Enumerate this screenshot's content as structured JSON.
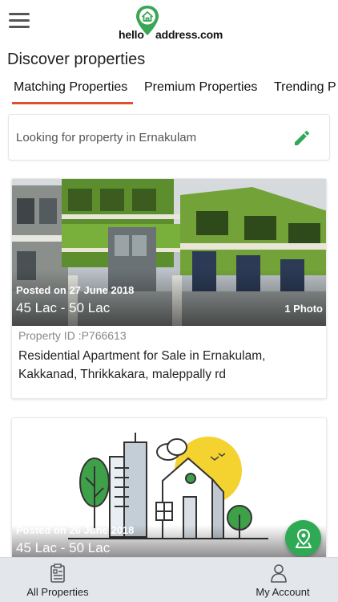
{
  "header": {
    "logo_word_left": "hello",
    "logo_word_right": "address.com",
    "brand_color": "#3aa655",
    "menu_icon": "hamburger-menu-icon"
  },
  "page_title": "Discover properties",
  "tabs": [
    {
      "label": "Matching Properties",
      "active": true
    },
    {
      "label": "Premium Properties",
      "active": false
    },
    {
      "label": "Trending P",
      "active": false
    }
  ],
  "accent_color": "#e0502a",
  "search": {
    "text": "Looking for property in Ernakulam",
    "edit_icon": "pencil-edit-icon"
  },
  "listings": [
    {
      "posted": "Posted on 27 June 2018",
      "price": "45 Lac - 50 Lac",
      "photos": "1 Photo",
      "property_id": "Property ID :P766613",
      "title": "Residential Apartment for Sale in Ernakulam, Kakkanad, Thrikkakara, maleppally rd"
    },
    {
      "posted": "Posted on 26 June 2018",
      "price": "45 Lac - 50 Lac"
    }
  ],
  "fab": {
    "icon": "map-pin-icon",
    "color": "#2eaa55"
  },
  "bottom_nav": [
    {
      "label": "All Properties",
      "icon": "property-list-icon"
    },
    {
      "label": "My Account",
      "icon": "user-account-icon"
    }
  ]
}
